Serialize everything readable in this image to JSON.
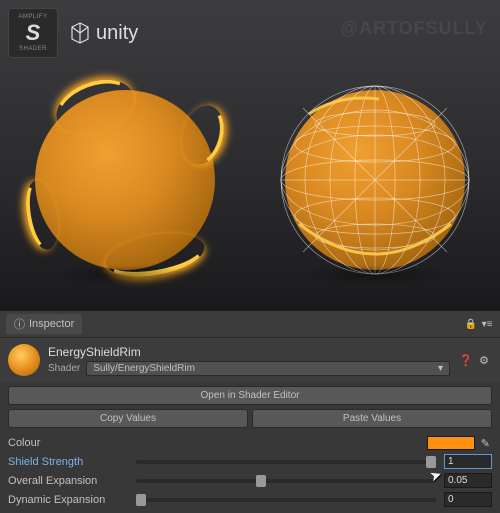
{
  "logos": {
    "amplify_top": "AMPLIFY",
    "amplify_s": "S",
    "amplify_bottom": "SHADER",
    "unity": "unity"
  },
  "watermark": "@ARTOFSULLY",
  "inspector": {
    "title": "Inspector",
    "material_name": "EnergyShieldRim",
    "shader_label": "Shader",
    "shader_value": "Sully/EnergyShieldRim",
    "open_editor": "Open in Shader Editor",
    "copy": "Copy Values",
    "paste": "Paste Values",
    "props": {
      "colour_label": "Colour",
      "colour_value": "#ff9010",
      "shield_label": "Shield Strength",
      "shield_value": "1",
      "overall_label": "Overall Expansion",
      "overall_value": "0.05",
      "dynamic_label": "Dynamic Expansion",
      "dynamic_value": "0"
    }
  }
}
